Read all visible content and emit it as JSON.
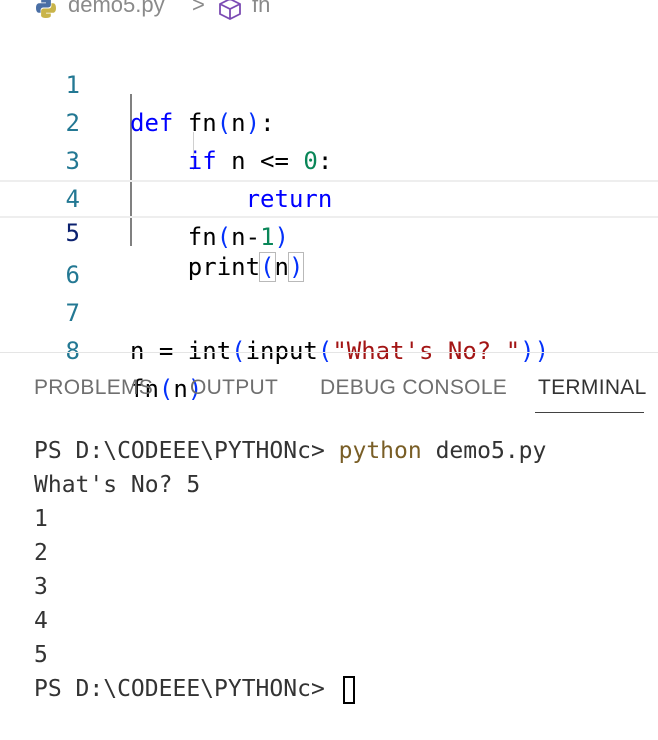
{
  "breadcrumb": {
    "file": "demo5.py",
    "separator": ">",
    "symbol": "fn"
  },
  "editor": {
    "line_numbers": [
      "1",
      "2",
      "3",
      "4",
      "5",
      "6",
      "7",
      "8"
    ],
    "lines": {
      "l1": {
        "kw": "def",
        "sp": " ",
        "name": "fn",
        "open": "(",
        "arg": "n",
        "close": ")",
        "colon": ":"
      },
      "l2": {
        "indent": "    ",
        "kw": "if",
        "rest": " n <= ",
        "num": "0",
        "colon": ":"
      },
      "l3": {
        "indent": "        ",
        "kw": "return"
      },
      "l4": {
        "indent": "    ",
        "name": "fn",
        "open": "(",
        "arg": "n-",
        "num": "1",
        "close": ")"
      },
      "l5": {
        "indent": "    ",
        "name": "print",
        "open": "(",
        "arg": "n",
        "close": ")"
      },
      "l7": {
        "a": "n = ",
        "b": "int",
        "open1": "(",
        "c": "input",
        "open2": "(",
        "str": "\"What's No? \"",
        "close2": ")",
        "close1": ")"
      },
      "l8": {
        "name": "fn",
        "open": "(",
        "arg": "n",
        "close": ")"
      }
    }
  },
  "panel": {
    "tabs": [
      "PROBLEMS",
      "OUTPUT",
      "DEBUG CONSOLE",
      "TERMINAL"
    ],
    "active_tab": "TERMINAL"
  },
  "terminal": {
    "prompt": "PS D:\\CODEEE\\PYTHONc> ",
    "command": "python",
    "command_arg": " demo5.py",
    "input_line": "What's No? 5",
    "output": [
      "1",
      "2",
      "3",
      "4",
      "5"
    ],
    "final_prompt": "PS D:\\CODEEE\\PYTHONc> "
  },
  "colors": {
    "keyword": "#0000ff",
    "number": "#098658",
    "string": "#a31515",
    "line_number": "#237893",
    "terminal_command": "#795e26"
  }
}
